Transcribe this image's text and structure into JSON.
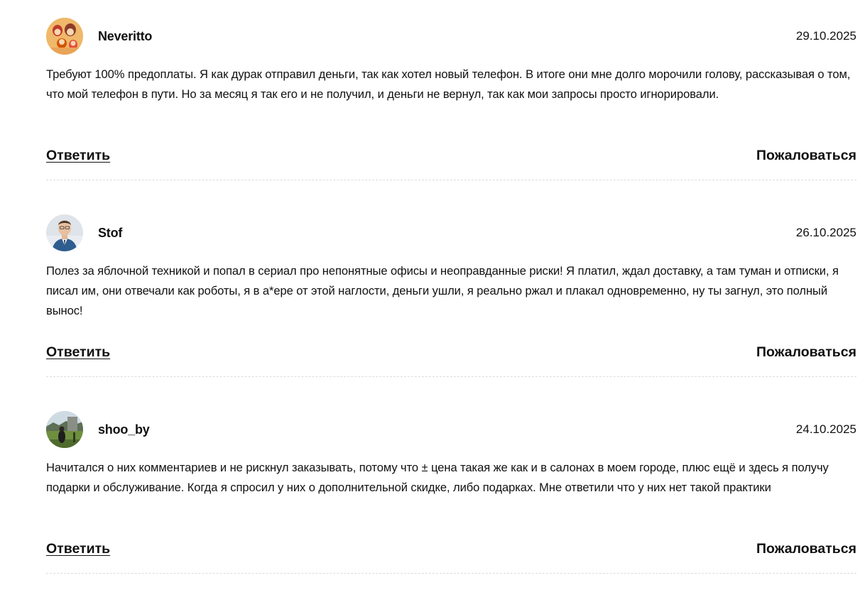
{
  "comments": [
    {
      "author": "Neveritto",
      "date": "29.10.2025",
      "text": "Требуют 100% предоплаты. Я как дурак отправил деньги, так как хотел новый телефон. В итоге они мне долго морочили голову, рассказывая о том, что мой телефон в пути. Но за месяц я так его и не получил, и деньги не вернул, так как мои запросы просто игнорировали.",
      "avatar_icon": "avatar-family-illustration"
    },
    {
      "author": "Stof",
      "date": "26.10.2025",
      "text": "Полез за яблочной техникой и попал в сериал про непонятные офисы и неоправданные риски! Я платил, ждал доставку, а там туман и отписки, я писал им, они отвечали как роботы, я в а*ере от этой наглости, деньги ушли, я реально ржал и плакал одновременно, ну ты загнул, это полный вынос!",
      "avatar_icon": "avatar-man-portrait"
    },
    {
      "author": "shoo_by",
      "date": "24.10.2025",
      "text": "Начитался о них комментариев и не рискнул заказывать, потому что ± цена такая же как и в салонах в моем городе, плюс ещё и здесь я получу подарки и обслуживание. Когда я спросил у них о дополнительной скидке, либо подарках. Мне ответили что у них нет такой практики",
      "avatar_icon": "avatar-outdoor-photo"
    }
  ],
  "actions": {
    "reply_label": "Ответить",
    "report_label": "Пожаловаться"
  }
}
